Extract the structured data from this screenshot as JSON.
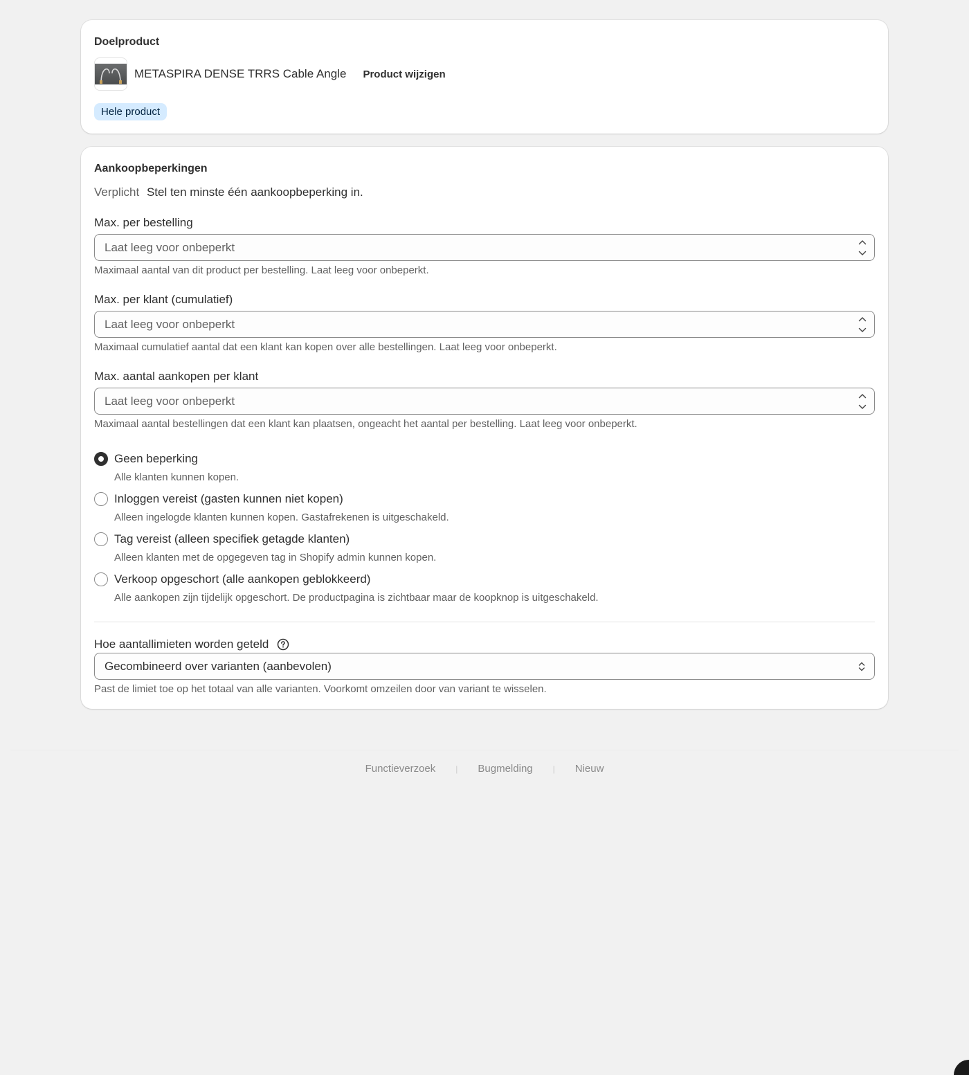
{
  "target_product": {
    "title": "Doelproduct",
    "product_name": "METASPIRA DENSE TRRS Cable Angle",
    "change_label": "Product wijzigen",
    "scope_badge": "Hele product"
  },
  "limits": {
    "title": "Aankoopbeperkingen",
    "required_label": "Verplicht",
    "required_text": "Stel ten minste één aankoopbeperking in.",
    "fields": [
      {
        "label": "Max. per bestelling",
        "placeholder": "Laat leeg voor onbeperkt",
        "value": "",
        "help": "Maximaal aantal van dit product per bestelling. Laat leeg voor onbeperkt."
      },
      {
        "label": "Max. per klant (cumulatief)",
        "placeholder": "Laat leeg voor onbeperkt",
        "value": "",
        "help": "Maximaal cumulatief aantal dat een klant kan kopen over alle bestellingen. Laat leeg voor onbeperkt."
      },
      {
        "label": "Max. aantal aankopen per klant",
        "placeholder": "Laat leeg voor onbeperkt",
        "value": "",
        "help": "Maximaal aantal bestellingen dat een klant kan plaatsen, ongeacht het aantal per bestelling. Laat leeg voor onbeperkt."
      }
    ],
    "access_options": [
      {
        "label": "Geen beperking",
        "help": "Alle klanten kunnen kopen.",
        "checked": true
      },
      {
        "label": "Inloggen vereist (gasten kunnen niet kopen)",
        "help": "Alleen ingelogde klanten kunnen kopen. Gastafrekenen is uitgeschakeld.",
        "checked": false
      },
      {
        "label": "Tag vereist (alleen specifiek getagde klanten)",
        "help": "Alleen klanten met de opgegeven tag in Shopify admin kunnen kopen.",
        "checked": false
      },
      {
        "label": "Verkoop opgeschort (alle aankopen geblokkeerd)",
        "help": "Alle aankopen zijn tijdelijk opgeschort. De productpagina is zichtbaar maar de koopknop is uitgeschakeld.",
        "checked": false
      }
    ],
    "count_mode": {
      "label": "Hoe aantallimieten worden geteld",
      "selected": "Gecombineerd over varianten (aanbevolen)",
      "help": "Past de limiet toe op het totaal van alle varianten. Voorkomt omzeilen door van variant te wisselen."
    }
  },
  "footer": {
    "links": [
      "Functieverzoek",
      "Bugmelding",
      "Nieuw"
    ]
  },
  "colors": {
    "background": "#f1f1f1",
    "card": "#ffffff",
    "badge_bg": "#d5ebff",
    "text": "#303030",
    "muted": "#616161"
  }
}
